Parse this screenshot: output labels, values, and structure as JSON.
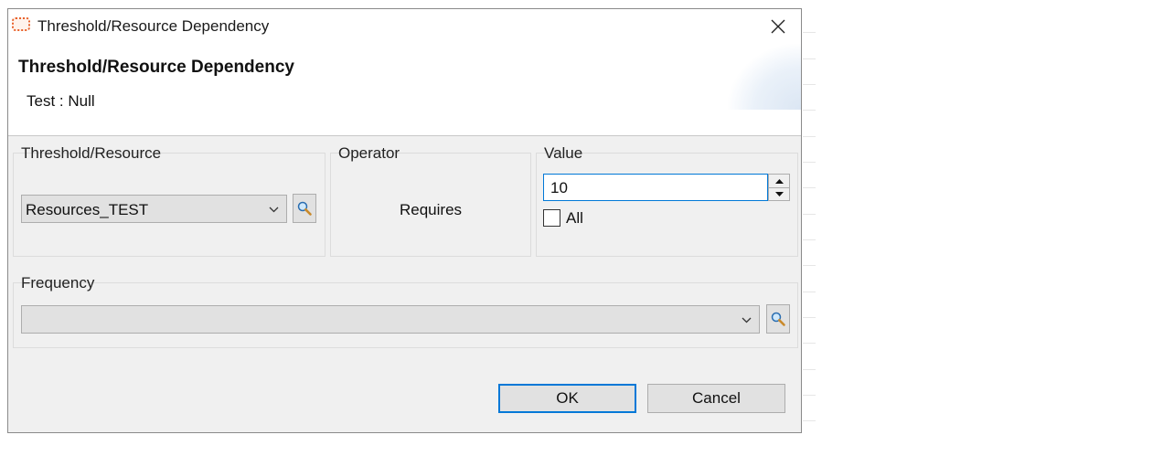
{
  "window": {
    "title": "Threshold/Resource Dependency",
    "close_glyph": "✕"
  },
  "banner": {
    "heading": "Threshold/Resource Dependency",
    "subtitle": "Test : Null"
  },
  "threshold_resource": {
    "label": "Threshold/Resource",
    "selected": "Resources_TEST"
  },
  "operator": {
    "label": "Operator",
    "value": "Requires"
  },
  "value_group": {
    "label": "Value",
    "value": "10",
    "all_label": "All",
    "all_checked": false
  },
  "frequency": {
    "label": "Frequency",
    "selected": ""
  },
  "buttons": {
    "ok": "OK",
    "cancel": "Cancel"
  },
  "icons": {
    "app": "app-window-icon",
    "lookup": "magnifier-icon",
    "dropdown": "chevron-down-icon"
  },
  "colors": {
    "focus": "#0078d7",
    "app_icon": "#e8622c"
  }
}
